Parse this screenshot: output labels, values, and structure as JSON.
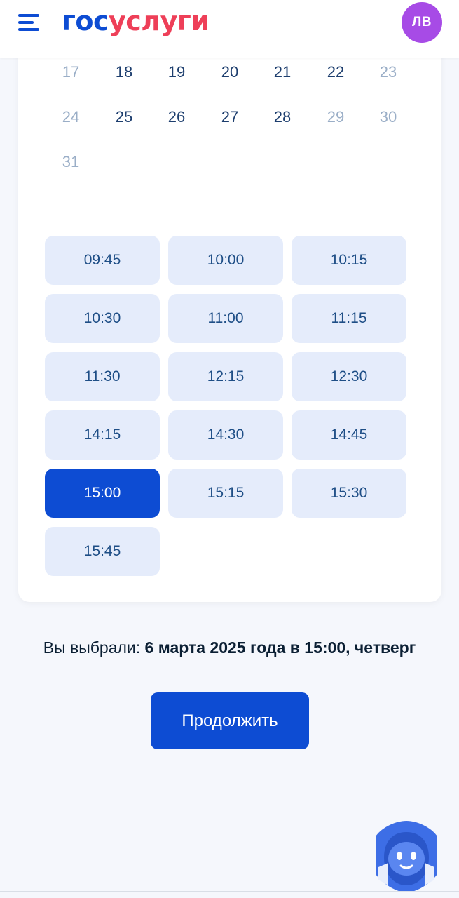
{
  "header": {
    "logo_part1": "гос",
    "logo_part2": "услуги",
    "avatar_initials": "ЛВ",
    "avatar_color": "#a74be6",
    "menu_icon": "hamburger-menu-icon"
  },
  "calendar": {
    "rows": [
      [
        {
          "day": "17",
          "available": false
        },
        {
          "day": "18",
          "available": true
        },
        {
          "day": "19",
          "available": true
        },
        {
          "day": "20",
          "available": true
        },
        {
          "day": "21",
          "available": true
        },
        {
          "day": "22",
          "available": true
        },
        {
          "day": "23",
          "available": false
        }
      ],
      [
        {
          "day": "24",
          "available": false
        },
        {
          "day": "25",
          "available": true
        },
        {
          "day": "26",
          "available": true
        },
        {
          "day": "27",
          "available": true
        },
        {
          "day": "28",
          "available": true
        },
        {
          "day": "29",
          "available": false
        },
        {
          "day": "30",
          "available": false
        }
      ],
      [
        {
          "day": "31",
          "available": false
        }
      ]
    ]
  },
  "time_slots": [
    {
      "time": "09:45",
      "selected": false
    },
    {
      "time": "10:00",
      "selected": false
    },
    {
      "time": "10:15",
      "selected": false
    },
    {
      "time": "10:30",
      "selected": false
    },
    {
      "time": "11:00",
      "selected": false
    },
    {
      "time": "11:15",
      "selected": false
    },
    {
      "time": "11:30",
      "selected": false
    },
    {
      "time": "12:15",
      "selected": false
    },
    {
      "time": "12:30",
      "selected": false
    },
    {
      "time": "14:15",
      "selected": false
    },
    {
      "time": "14:30",
      "selected": false
    },
    {
      "time": "14:45",
      "selected": false
    },
    {
      "time": "15:00",
      "selected": true
    },
    {
      "time": "15:15",
      "selected": false
    },
    {
      "time": "15:30",
      "selected": false
    },
    {
      "time": "15:45",
      "selected": false
    }
  ],
  "selection": {
    "label": "Вы выбрали: ",
    "value": "6 марта 2025 года в 15:00, четверг"
  },
  "continue_button": {
    "label": "Продолжить"
  },
  "assistant": {
    "icon": "robot-assistant-icon"
  },
  "colors": {
    "primary": "#0d4cd3",
    "logo_red": "#ee3f58",
    "slot_bg": "#e5ecfb",
    "slot_text": "#1e4e86",
    "muted_day": "#9aaec7",
    "page_bg": "#f5f7fc"
  }
}
